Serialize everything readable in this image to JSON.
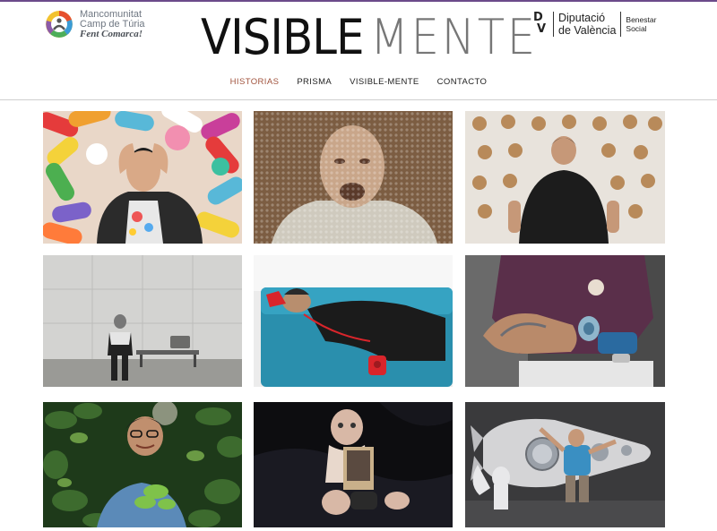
{
  "header": {
    "mancomunitat": {
      "line1": "Mancomunitat",
      "line2": "Camp de Túria",
      "tagline": "Fent Comarca!"
    },
    "brand": {
      "part1": "VISIBLE",
      "part2": "MENTE"
    },
    "diputacio": {
      "mark_d": "D",
      "mark_v": "V",
      "line1": "Diputació",
      "line2": "de València",
      "area1": "Benestar",
      "area2": "Social"
    }
  },
  "nav": {
    "items": [
      {
        "label": "HISTORIAS",
        "active": true
      },
      {
        "label": "PRISMA",
        "active": false
      },
      {
        "label": "VISIBLE-MENTE",
        "active": false
      },
      {
        "label": "CONTACTO",
        "active": false
      }
    ],
    "active_color": "#a0523c"
  },
  "gallery": {
    "columns": 3,
    "rows": 3,
    "tiles": [
      {
        "subject": "man-among-giant-pills"
      },
      {
        "subject": "face-behind-wet-glass"
      },
      {
        "subject": "man-facing-wall-of-hooks"
      },
      {
        "subject": "man-sitting-by-concrete-wall"
      },
      {
        "subject": "man-on-sofa-with-red-phone"
      },
      {
        "subject": "arm-holding-dumbbell"
      },
      {
        "subject": "woman-lying-in-leaves"
      },
      {
        "subject": "dolls-on-dark-fabric"
      },
      {
        "subject": "man-with-rocket-mural"
      }
    ]
  },
  "colors": {
    "accent": "#6b4a8a",
    "nav_active": "#a0523c",
    "rule": "#cfcfcf"
  }
}
